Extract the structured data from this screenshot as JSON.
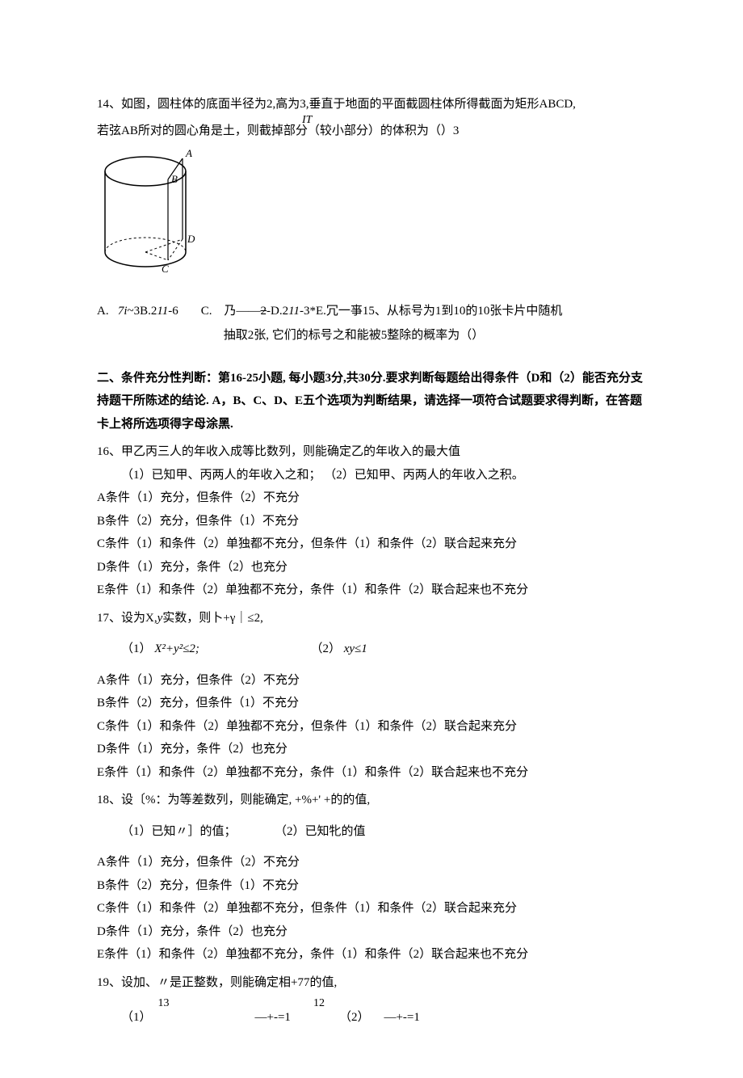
{
  "q14": {
    "stem_line1": "14、如图，圆柱体的底面半径为2,高为3,垂直于地面的平面截圆柱体所得截面为矩形ABCD,",
    "it_label": "IT",
    "stem_line2": "若弦AB所对的圆心角是土，则截掉部分（较小部分）的体积为（）3",
    "opt_a": "A.   7i~3B.211-6",
    "opt_c_line1": "C.    乃——2-D.211-3*E.冗一亊15、从标号为1到10的10张卡片中随机",
    "opt_c_line2": "抽取2张, 它们的标号之和能被5整除的概率为（）",
    "strike_text": "2"
  },
  "section2": {
    "header": "二、条件充分性判断：第16-25小题, 每小题3分,共30分.要求判断每题给出得条件（D和（2）能否充分支持题干所陈述的结论. A，B、C、D、E五个选项为判断结果，请选择一项符合试题要求得判断，在答题卡上将所选项得字母涂黑."
  },
  "answer_options": {
    "a": "A条件（1）充分，但条件（2）不充分",
    "b": "B条件（2）充分，但条件（1）不充分",
    "c": "C条件（1）和条件（2）单独都不充分，但条件（1）和条件（2）联合起来充分",
    "d": "D条件（1）充分，条件（2）也充分",
    "e": "E条件（1）和条件（2）单独都不充分，条件（1）和条件（2）联合起来也不充分"
  },
  "q16": {
    "stem": "16、甲乙丙三人的年收入成等比数列，则能确定乙的年收入的最大值",
    "conds": "（1）已知甲、丙两人的年收入之和；    （2）已知甲、丙两人的年收入之积。"
  },
  "q17": {
    "stem": "17、设为X,y实数，则卜+γ｜≤2,",
    "cond1_label": "（1）",
    "cond1_body": "X²+y²≤2;",
    "cond2_label": "（2）",
    "cond2_body": "xy≤1"
  },
  "q18": {
    "stem": "18、设〔%：为等差数列，则能确定, +%+' +的的值,",
    "cond1": "（1）已知〃］的值；",
    "cond2": "（2）已知牝的值"
  },
  "q19": {
    "stem": "19、设加、〃是正整数，则能确定相+77的值,",
    "frac_top_1": "13",
    "frac_top_2": "12",
    "row_label1": "（1）",
    "row_mid": "—+-=1",
    "row_label2": "（2）",
    "row_right": "—+-=1"
  },
  "figure_labels": {
    "A": "A",
    "B": "B",
    "C": "C",
    "D": "D"
  }
}
